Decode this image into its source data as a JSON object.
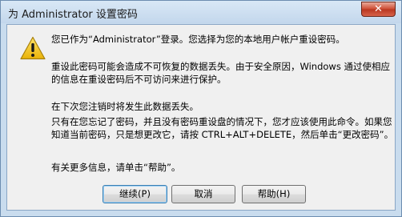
{
  "window": {
    "title": "为 Administrator 设置密码",
    "close_glyph": "✕"
  },
  "icon": {
    "name": "warning-icon",
    "color": "#f2c81e"
  },
  "message": {
    "line1": "您已作为“Administrator”登录。您选择为您的本地用户帐户重设密码。",
    "para2": "重设此密码可能会造成不可恢复的数据丢失。由于安全原因，Windows 通过使相应的信息在重设密码后不可访问来进行保护。",
    "line3": "在下次您注销时将发生此数据丢失。",
    "para4": "只有在您忘记了密码，并且没有密码重设盘的情况下，您才应该使用此命令。如果您知道当前密码，只是想更改它，请按 CTRL+ALT+DELETE，然后单击“更改密码”。",
    "line5": "有关更多信息，请单击“帮助”。"
  },
  "buttons": {
    "continue": "继续(P)",
    "cancel": "取消",
    "help": "帮助(H)"
  }
}
